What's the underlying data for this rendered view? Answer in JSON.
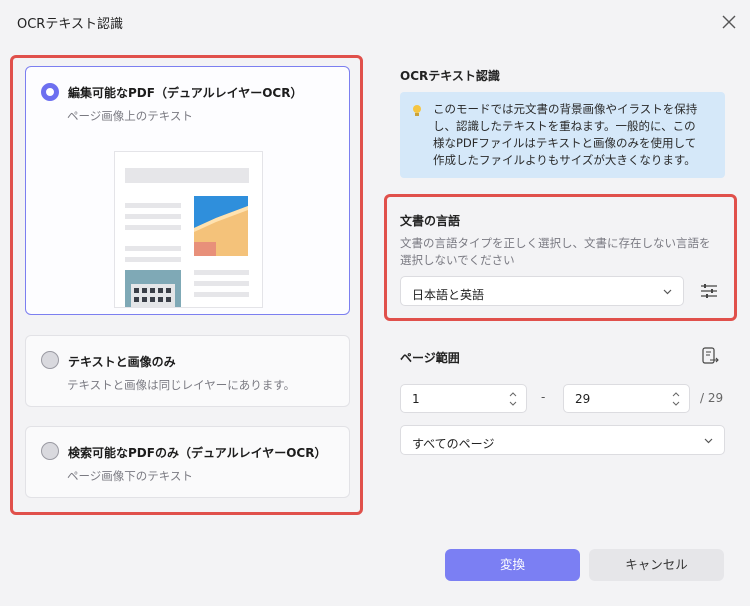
{
  "dialog": {
    "title": "OCRテキスト認識"
  },
  "modes": [
    {
      "title": "編集可能なPDF（デュアルレイヤーOCR）",
      "subtitle": "ページ画像上のテキスト",
      "selected": true
    },
    {
      "title": "テキストと画像のみ",
      "subtitle": "テキストと画像は同じレイヤーにあります。",
      "selected": false
    },
    {
      "title": "検索可能なPDFのみ（デュアルレイヤーOCR）",
      "subtitle": "ページ画像下のテキスト",
      "selected": false
    }
  ],
  "right": {
    "heading": "OCRテキスト認識",
    "info_lines": [
      "このモードでは元文書の背景画像やイラストを保持",
      "し、認識したテキストを重ねます。一般的に、この",
      "様なPDFファイルはテキストと画像のみを使用して",
      "作成したファイルよりもサイズが大きくなります。"
    ]
  },
  "language": {
    "label": "文書の言語",
    "desc_lines": [
      "文書の言語タイプを正しく選択し、文書に存在しない言語を",
      "選択しないでください"
    ],
    "selected": "日本語と英語"
  },
  "page_range": {
    "label": "ページ範囲",
    "from": "1",
    "dash": "-",
    "to": "29",
    "total": "/ 29",
    "option": "すべてのページ"
  },
  "buttons": {
    "convert": "変換",
    "cancel": "キャンセル"
  },
  "colors": {
    "accent": "#7b7ff3",
    "highlight": "#e0504b",
    "info_bg": "#d5e8f9"
  }
}
